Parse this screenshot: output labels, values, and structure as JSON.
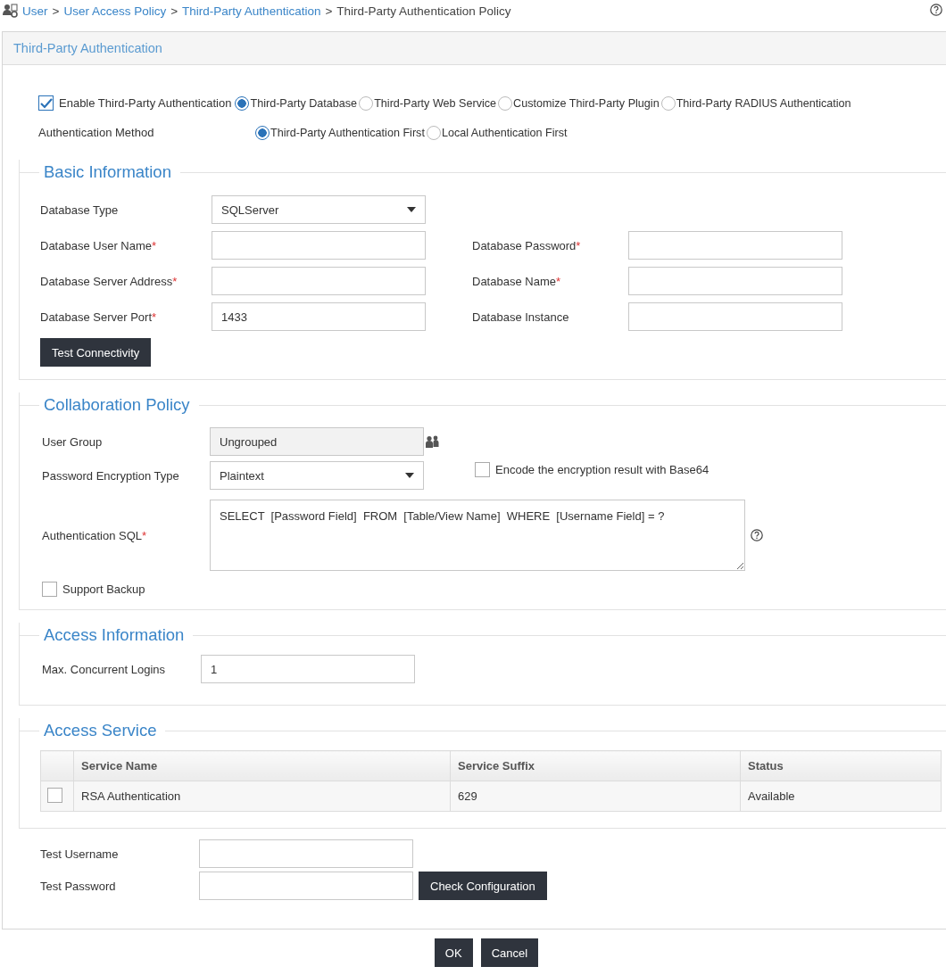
{
  "breadcrumb": [
    {
      "label": "User",
      "kind": "link"
    },
    {
      "separator": ">",
      "label": "User Access Policy",
      "kind": "link"
    },
    {
      "separator": ">",
      "label": "Third-Party Authentication",
      "kind": "link"
    },
    {
      "separator": ">",
      "label": "Third-Party Authentication Policy",
      "kind": "current"
    }
  ],
  "panel": {
    "title": "Third-Party Authentication"
  },
  "enable": {
    "label": "Enable Third-Party Authentication",
    "checked": true
  },
  "source_options": [
    {
      "label": "Third-Party Database",
      "selected": true
    },
    {
      "label": "Third-Party Web Service",
      "selected": false
    },
    {
      "label": "Customize Third-Party Plugin",
      "selected": false
    },
    {
      "label": "Third-Party RADIUS Authentication",
      "selected": false
    }
  ],
  "auth_method": {
    "label": "Authentication Method",
    "options": [
      {
        "label": "Third-Party Authentication First",
        "selected": true
      },
      {
        "label": "Local Authentication First",
        "selected": false
      }
    ]
  },
  "basic": {
    "title": "Basic Information",
    "rows": [
      [
        {
          "label": "Database Type",
          "kind": "select",
          "value": "SQLServer"
        }
      ],
      [
        {
          "label": "Database User Name",
          "required_mark": "*",
          "kind": "input"
        },
        {
          "label": "Database Password",
          "required_mark": "*",
          "kind": "input"
        }
      ],
      [
        {
          "label": "Database Server Address",
          "required_mark": "*",
          "kind": "input"
        },
        {
          "label": "Database Name",
          "required_mark": "*",
          "kind": "input"
        }
      ],
      [
        {
          "label": "Database Server Port",
          "required_mark": "*",
          "kind": "input",
          "value": "1433"
        },
        {
          "label": "Database Instance",
          "kind": "input"
        }
      ]
    ],
    "button": "Test Connectivity"
  },
  "collaboration": {
    "title": "Collaboration Policy",
    "user_group": {
      "label": "User Group",
      "value": "Ungrouped"
    },
    "encryption": {
      "label": "Password Encryption Type",
      "value": "Plaintext"
    },
    "base64": {
      "label": "Encode the encryption result with Base64",
      "checked": false
    },
    "sql": {
      "label": "Authentication SQL",
      "required_mark": "*",
      "value": "SELECT  [Password Field]  FROM  [Table/View Name]  WHERE  [Username Field] = ?"
    },
    "backup": {
      "label": "Support Backup",
      "checked": false
    }
  },
  "access_info": {
    "title": "Access Information",
    "label": "Max. Concurrent Logins",
    "value": "1"
  },
  "access_service": {
    "title": "Access Service",
    "columns": [
      "Service Name",
      "Service Suffix",
      "Status"
    ],
    "rows": [
      {
        "checked": false,
        "cells": [
          "RSA Authentication",
          "629",
          "Available"
        ]
      }
    ]
  },
  "test": {
    "username_label": "Test Username",
    "password_label": "Test Password",
    "button": "Check Configuration"
  },
  "buttons": [
    "OK",
    "Cancel"
  ]
}
